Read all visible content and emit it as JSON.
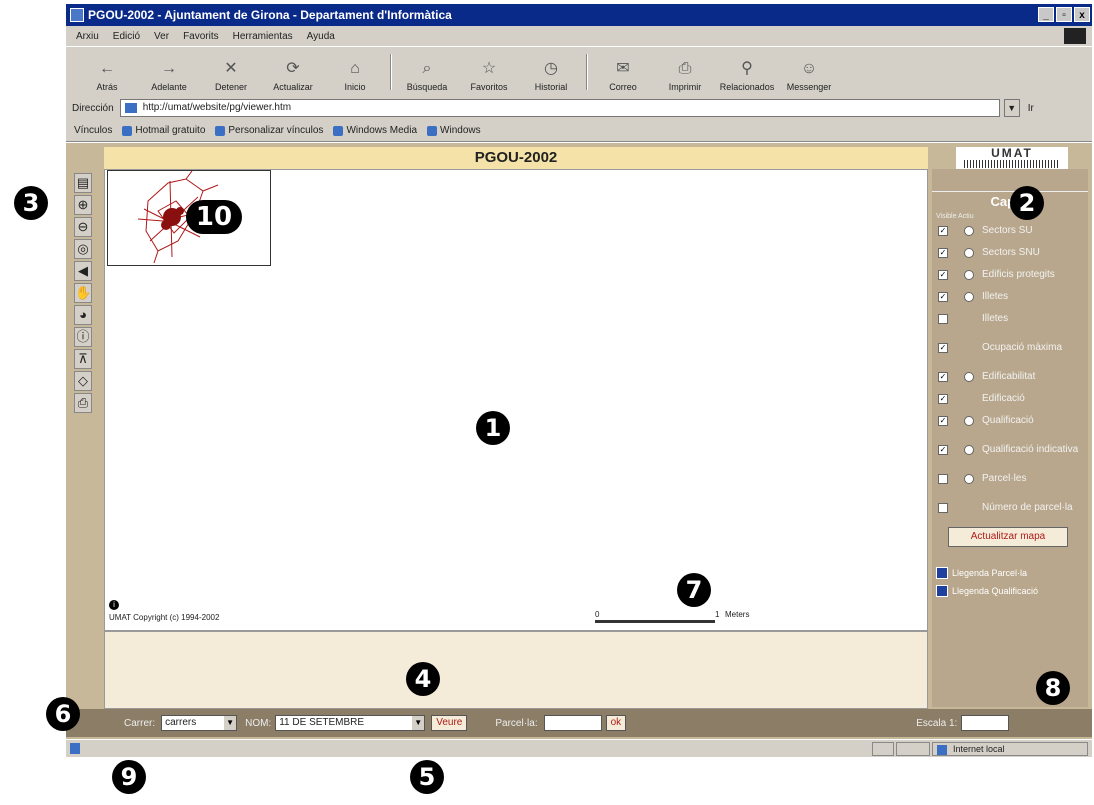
{
  "window": {
    "title": "PGOU-2002 - Ajuntament de Girona - Departament d'Informàtica",
    "controls": [
      "_",
      "▫",
      "x"
    ]
  },
  "menu": [
    "Arxiu",
    "Edició",
    "Ver",
    "Favorits",
    "Herramientas",
    "Ayuda"
  ],
  "toolbar": [
    {
      "icon": "back-arrow-icon",
      "label": "Atrás",
      "glyph": "←"
    },
    {
      "icon": "forward-arrow-icon",
      "label": "Adelante",
      "glyph": "→"
    },
    {
      "icon": "stop-icon",
      "label": "Detener",
      "glyph": "✕"
    },
    {
      "icon": "refresh-icon",
      "label": "Actualizar",
      "glyph": "⟳"
    },
    {
      "icon": "home-icon",
      "label": "Inicio",
      "glyph": "⌂"
    },
    {
      "icon": "search-icon",
      "label": "Búsqueda",
      "glyph": "⌕"
    },
    {
      "icon": "favorites-icon",
      "label": "Favoritos",
      "glyph": "☆"
    },
    {
      "icon": "history-icon",
      "label": "Historial",
      "glyph": "◷"
    },
    {
      "icon": "mail-icon",
      "label": "Correo",
      "glyph": "✉"
    },
    {
      "icon": "print-icon",
      "label": "Imprimir",
      "glyph": "⎙"
    },
    {
      "icon": "related-icon",
      "label": "Relacionados",
      "glyph": "⚲"
    },
    {
      "icon": "messenger-icon",
      "label": "Messenger",
      "glyph": "☺"
    }
  ],
  "address": {
    "label": "Dirección",
    "url": "http://umat/website/pg/viewer.htm",
    "go_label": "Ir"
  },
  "links": {
    "label": "Vínculos",
    "items": [
      "Hotmail gratuito",
      "Personalizar vínculos",
      "Windows Media",
      "Windows"
    ]
  },
  "page": {
    "title": "PGOU-2002",
    "logo_text": "UMAT"
  },
  "tools": [
    {
      "name": "layers-toggle-icon",
      "glyph": "▤"
    },
    {
      "name": "zoom-in-icon",
      "glyph": "⊕"
    },
    {
      "name": "zoom-out-icon",
      "glyph": "⊖"
    },
    {
      "name": "zoom-extent-icon",
      "glyph": "◎"
    },
    {
      "name": "previous-view-icon",
      "glyph": "◀"
    },
    {
      "name": "pan-hand-icon",
      "glyph": "✋"
    },
    {
      "name": "globe-icon",
      "glyph": "◕"
    },
    {
      "name": "identify-icon",
      "glyph": "ⓘ"
    },
    {
      "name": "measure-icon",
      "glyph": "⊼"
    },
    {
      "name": "eraser-icon",
      "glyph": "◇"
    },
    {
      "name": "print-map-icon",
      "glyph": "⎙"
    }
  ],
  "map": {
    "copyright": "UMAT Copyright (c) 1994-2002",
    "scale": {
      "start": "0",
      "end": "1",
      "unit": "Meters"
    }
  },
  "layers": {
    "title": "Capes",
    "col_headers": "Visible  Actiu",
    "items": [
      {
        "label": "Sectors SU",
        "visible": true,
        "radio": true,
        "tall": false
      },
      {
        "label": "Sectors SNU",
        "visible": true,
        "radio": true,
        "tall": false
      },
      {
        "label": "Edificis protegits",
        "visible": true,
        "radio": true,
        "tall": false
      },
      {
        "label": "Illetes",
        "visible": true,
        "radio": true,
        "tall": false
      },
      {
        "label": "Illetes",
        "visible": false,
        "radio": false,
        "tall": false
      },
      {
        "label": "Ocupació màxima",
        "visible": true,
        "radio": false,
        "tall": true
      },
      {
        "label": "Edificabilitat",
        "visible": true,
        "radio": true,
        "tall": false
      },
      {
        "label": "Edificació",
        "visible": true,
        "radio": false,
        "tall": false
      },
      {
        "label": "Qualificació",
        "visible": true,
        "radio": true,
        "tall": false
      },
      {
        "label": "Qualificació indicativa",
        "visible": true,
        "radio": true,
        "tall": true
      },
      {
        "label": "Parcel·les",
        "visible": false,
        "radio": true,
        "tall": false
      },
      {
        "label": "Número de parcel·la",
        "visible": false,
        "radio": false,
        "tall": true
      }
    ],
    "update_button": "Actualitzar mapa",
    "legend_links": [
      "Llegenda Parcel·la",
      "Llegenda Qualificació"
    ]
  },
  "search": {
    "carrer_label": "Carrer:",
    "carrer_value": "carrers",
    "nom_label": "NOM:",
    "nom_value": "11 DE SETEMBRE",
    "go_button": "Veure",
    "parcel_label": "Parcel·la:",
    "parcel_button": "ok",
    "scale_label": "Escala 1:"
  },
  "status": {
    "zone": "Internet local"
  },
  "callouts": [
    "1",
    "2",
    "3",
    "4",
    "5",
    "6",
    "7",
    "8",
    "9",
    "10"
  ]
}
